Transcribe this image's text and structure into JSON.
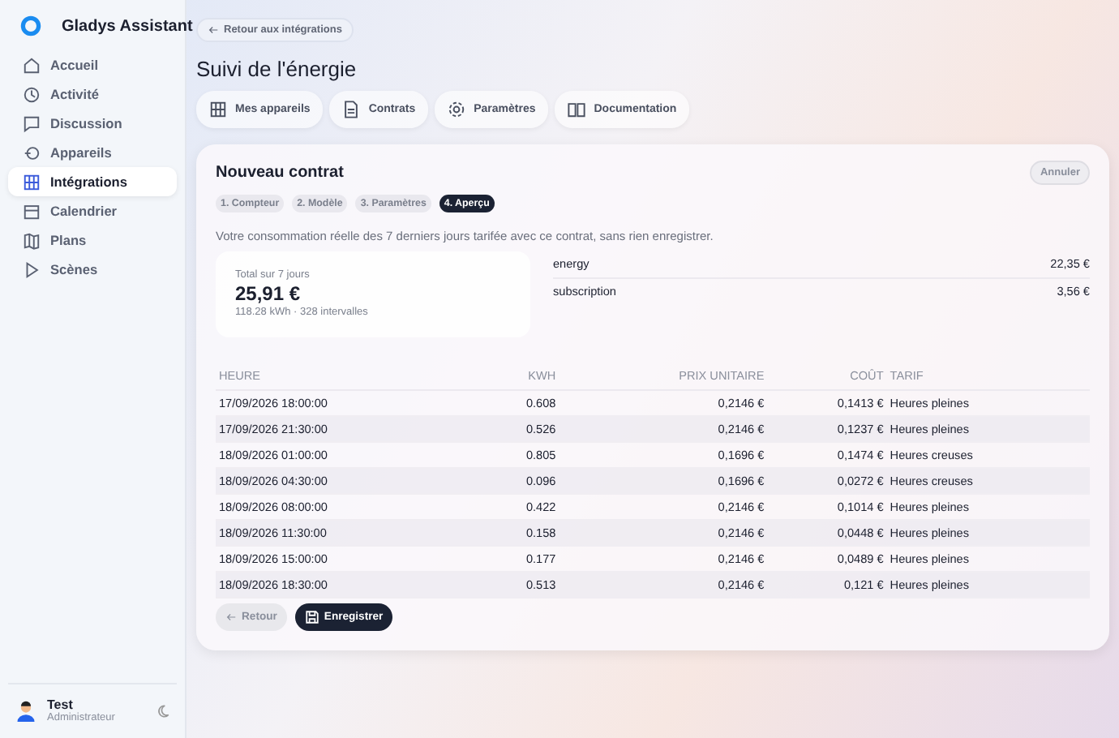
{
  "app": {
    "name": "Gladys Assistant"
  },
  "sidebar": {
    "items": [
      {
        "label": "Accueil",
        "selected": false
      },
      {
        "label": "Activité",
        "selected": false
      },
      {
        "label": "Discussion",
        "selected": false
      },
      {
        "label": "Appareils",
        "selected": false
      },
      {
        "label": "Intégrations",
        "selected": true
      },
      {
        "label": "Calendrier",
        "selected": false
      },
      {
        "label": "Plans",
        "selected": false
      },
      {
        "label": "Scènes",
        "selected": false
      }
    ],
    "user": {
      "name": "Test",
      "role": "Administrateur"
    }
  },
  "back_link": "Retour aux intégrations",
  "title": "Suivi de l'énergie",
  "tabs": [
    {
      "label": "Mes appareils"
    },
    {
      "label": "Contrats"
    },
    {
      "label": "Paramètres"
    },
    {
      "label": "Documentation"
    }
  ],
  "card": {
    "title": "Nouveau contrat",
    "cancel": "Annuler",
    "steps": [
      {
        "label": "1. Compteur",
        "selected": false
      },
      {
        "label": "2. Modèle",
        "selected": false
      },
      {
        "label": "3. Paramètres",
        "selected": false
      },
      {
        "label": "4. Aperçu",
        "selected": true
      }
    ],
    "description": "Votre consommation réelle des 7 derniers jours tarifée avec ce contrat, sans rien enregistrer.",
    "total": {
      "label": "Total sur 7 jours",
      "value": "25,91 €",
      "detail": "118.28 kWh · 328 intervalles"
    },
    "breakdown": [
      {
        "name": "energy",
        "value": "22,35 €"
      },
      {
        "name": "subscription",
        "value": "3,56 €"
      }
    ],
    "table": {
      "columns": [
        "HEURE",
        "KWH",
        "PRIX UNITAIRE",
        "COÛT",
        "TARIF"
      ],
      "rows": [
        [
          "17/09/2026 18:00:00",
          "0.608",
          "0,2146 €",
          "0,1413 €",
          "Heures pleines"
        ],
        [
          "17/09/2026 21:30:00",
          "0.526",
          "0,2146 €",
          "0,1237 €",
          "Heures pleines"
        ],
        [
          "18/09/2026 01:00:00",
          "0.805",
          "0,1696 €",
          "0,1474 €",
          "Heures creuses"
        ],
        [
          "18/09/2026 04:30:00",
          "0.096",
          "0,1696 €",
          "0,0272 €",
          "Heures creuses"
        ],
        [
          "18/09/2026 08:00:00",
          "0.422",
          "0,2146 €",
          "0,1014 €",
          "Heures pleines"
        ],
        [
          "18/09/2026 11:30:00",
          "0.158",
          "0,2146 €",
          "0,0448 €",
          "Heures pleines"
        ],
        [
          "18/09/2026 15:00:00",
          "0.177",
          "0,2146 €",
          "0,0489 €",
          "Heures pleines"
        ],
        [
          "18/09/2026 18:30:00",
          "0.513",
          "0,2146 €",
          "0,121 €",
          "Heures pleines"
        ]
      ]
    },
    "buttons": [
      {
        "label": "Retour",
        "kind": "secondary"
      },
      {
        "label": "Enregistrer",
        "kind": "primary"
      }
    ]
  }
}
